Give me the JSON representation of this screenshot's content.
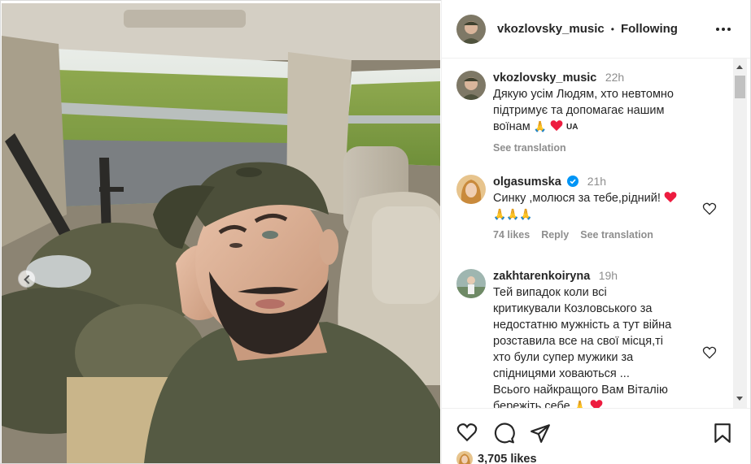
{
  "header": {
    "username": "vkozlovsky_music",
    "separator": "•",
    "follow_status": "Following"
  },
  "comments": [
    {
      "username": "vkozlovsky_music",
      "time": "22h",
      "text_lines": [
        "Дякую усім Людям, хто невтомно",
        "підтримує та допомагає нашим",
        "воїнам"
      ],
      "flag_text": "UA",
      "translation_label": "See translation"
    },
    {
      "username": "olgasumska",
      "time": "21h",
      "text_lines": [
        "Синку ,молюся за тебе,рідний!"
      ],
      "likes": "74 likes",
      "reply_label": "Reply",
      "translation_label": "See translation"
    },
    {
      "username": "zakhtarenkoiryna",
      "time": "19h",
      "text_lines": [
        "Тей випадок коли всі",
        "критикували Козловського за",
        "недостатню мужність а тут війна",
        "розставила все на свої місця,ті",
        "хто були супер мужики за",
        "спідницями ховаються ...",
        "Всього найкращого Вам Віталію",
        "бережіть себе"
      ]
    }
  ],
  "footer": {
    "likes_count": "3,705 likes"
  },
  "icons": {
    "more": "more-options-icon",
    "like": "heart-icon",
    "comment": "comment-icon",
    "share": "share-icon",
    "save": "bookmark-icon",
    "verified": "verified-badge-icon"
  },
  "colors": {
    "text": "#262626",
    "muted": "#8e8e8e",
    "verified": "#0095f6",
    "heart_red": "#ed1c3f",
    "border": "#dbdbdb"
  }
}
